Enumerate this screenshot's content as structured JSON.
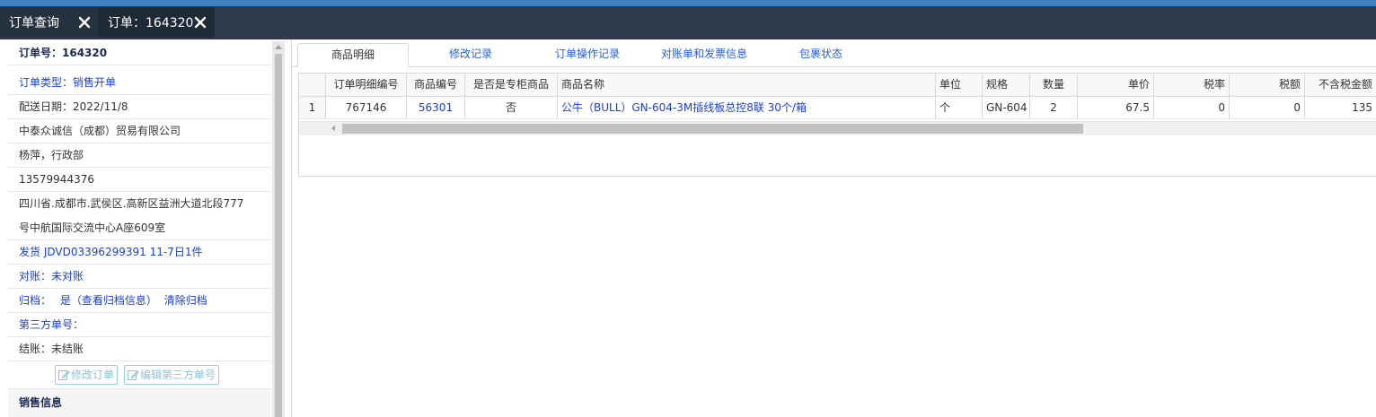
{
  "tabs": [
    {
      "label": "订单查询"
    },
    {
      "label": "订单：164320"
    }
  ],
  "left": {
    "order_no": "订单号：164320",
    "order_type": "订单类型：销售开单",
    "delivery_date": "配送日期：2022/11/8",
    "company": "中泰众诚信（成都）贸易有限公司",
    "contact": "杨萍，行政部",
    "phone": "13579944376",
    "address_line1": "四川省.成都市.武侯区.高新区益洲大道北段777",
    "address_line2": "号中航国际交流中心A座609室",
    "shipping": "发货 JDVD03396299391 11-7日1件",
    "reconcile": "对账：未对账",
    "archive_label": "归档：",
    "archive_value": "是（查看归档信息）",
    "archive_clear": "清除归档",
    "third_party": "第三方单号：",
    "settlement": "结账：未结账",
    "edit_order_btn": "修改订单",
    "edit_third_btn": "编辑第三方单号",
    "sales_section": "销售信息"
  },
  "subtabs": [
    "商品明细",
    "修改记录",
    "订单操作记录",
    "对账单和发票信息",
    "包裹状态"
  ],
  "grid": {
    "columns": [
      "",
      "订单明细编号",
      "商品编号",
      "是否是专柜商品",
      "商品名称",
      "单位",
      "规格",
      "数量",
      "单价",
      "税率",
      "税额",
      "不含税金额"
    ],
    "rows": [
      [
        "1",
        "767146",
        "56301",
        "否",
        "公牛（BULL）GN-604-3M插线板总控8联 30个/箱",
        "个",
        "GN-604",
        "2",
        "67.5",
        "0",
        "0",
        "135"
      ]
    ]
  },
  "colors": {
    "topbar": "#3e82c1",
    "tabbar": "#2f3b4a",
    "link": "#1c3fd6"
  },
  "icons": [
    "close-icon",
    "edit-icon"
  ]
}
